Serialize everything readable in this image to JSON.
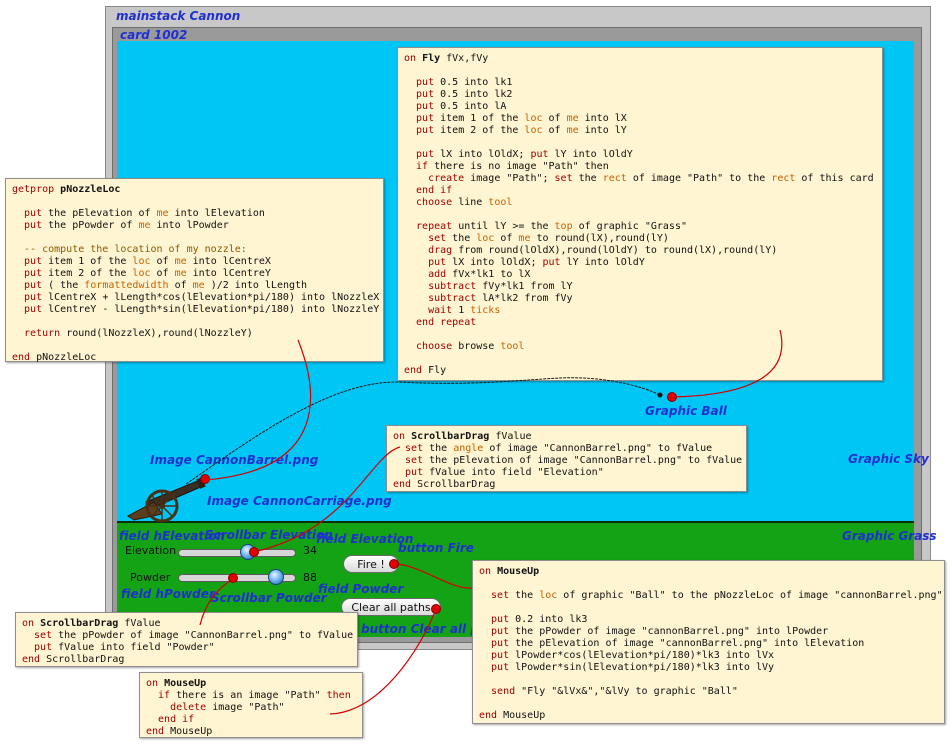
{
  "labels": {
    "mainstack": "mainstack Cannon",
    "card": "card 1002",
    "graphic_sky": "Graphic Sky",
    "graphic_grass": "Graphic Grass",
    "graphic_ball": "Graphic Ball",
    "image_barrel": "Image CannonBarrel.png",
    "image_carriage": "Image CannonCarriage.png",
    "field_helevation": "field hElevation",
    "scrollbar_elevation": "Scrollbar Elevation",
    "field_elevation": "field Elevation",
    "button_fire": "button Fire",
    "field_hpowder": "field hPowder",
    "scrollbar_powder": "Scrollbar Powder",
    "field_powder": "field Powder",
    "button_clear": "button Clear all paths"
  },
  "controls": {
    "elevation_label": "Elevation",
    "elevation_value": "34",
    "elevation_fraction": 0.34,
    "powder_label": "Powder",
    "powder_value": "88",
    "powder_fraction": 0.88,
    "fire_label": "Fire !",
    "clear_label": "Clear all paths"
  },
  "scripts": {
    "fly": [
      [
        {
          "c": "kw",
          "t": "on "
        },
        {
          "c": "bold",
          "t": "Fly"
        },
        {
          "c": "pl",
          "t": " fVx,fVy"
        }
      ],
      [],
      [
        {
          "c": "kw",
          "t": "  put"
        },
        {
          "c": "pl",
          "t": " 0.5 into lk1"
        }
      ],
      [
        {
          "c": "kw",
          "t": "  put"
        },
        {
          "c": "pl",
          "t": " 0.5 into lk2"
        }
      ],
      [
        {
          "c": "kw",
          "t": "  put"
        },
        {
          "c": "pl",
          "t": " 0.5 into lA"
        }
      ],
      [
        {
          "c": "kw",
          "t": "  put"
        },
        {
          "c": "pl",
          "t": " item 1 of the "
        },
        {
          "c": "or",
          "t": "loc"
        },
        {
          "c": "pl",
          "t": " of "
        },
        {
          "c": "or",
          "t": "me"
        },
        {
          "c": "pl",
          "t": " into lX"
        }
      ],
      [
        {
          "c": "kw",
          "t": "  put"
        },
        {
          "c": "pl",
          "t": " item 2 of the "
        },
        {
          "c": "or",
          "t": "loc"
        },
        {
          "c": "pl",
          "t": " of "
        },
        {
          "c": "or",
          "t": "me"
        },
        {
          "c": "pl",
          "t": " into lY"
        }
      ],
      [],
      [
        {
          "c": "kw",
          "t": "  put"
        },
        {
          "c": "pl",
          "t": " lX into lOldX; "
        },
        {
          "c": "kw",
          "t": "put"
        },
        {
          "c": "pl",
          "t": " lY into lOldY"
        }
      ],
      [
        {
          "c": "kw",
          "t": "  if"
        },
        {
          "c": "pl",
          "t": " there is no image \"Path\" then"
        }
      ],
      [
        {
          "c": "kw",
          "t": "    create"
        },
        {
          "c": "pl",
          "t": " image \"Path\"; "
        },
        {
          "c": "kw",
          "t": "set"
        },
        {
          "c": "pl",
          "t": " the "
        },
        {
          "c": "or",
          "t": "rect"
        },
        {
          "c": "pl",
          "t": " of image \"Path\" to the "
        },
        {
          "c": "or",
          "t": "rect"
        },
        {
          "c": "pl",
          "t": " of this card"
        }
      ],
      [
        {
          "c": "kw",
          "t": "  end if"
        }
      ],
      [
        {
          "c": "kw",
          "t": "  choose"
        },
        {
          "c": "pl",
          "t": " line "
        },
        {
          "c": "or",
          "t": "tool"
        }
      ],
      [],
      [
        {
          "c": "kw",
          "t": "  repeat"
        },
        {
          "c": "pl",
          "t": " until lY >= the "
        },
        {
          "c": "or",
          "t": "top"
        },
        {
          "c": "pl",
          "t": " of graphic \"Grass\""
        }
      ],
      [
        {
          "c": "kw",
          "t": "    set"
        },
        {
          "c": "pl",
          "t": " the "
        },
        {
          "c": "or",
          "t": "loc"
        },
        {
          "c": "pl",
          "t": " of "
        },
        {
          "c": "or",
          "t": "me"
        },
        {
          "c": "pl",
          "t": " to round(lX),round(lY)"
        }
      ],
      [
        {
          "c": "kw",
          "t": "    drag"
        },
        {
          "c": "pl",
          "t": " from round(lOldX),round(lOldY) to round(lX),round(lY)"
        }
      ],
      [
        {
          "c": "kw",
          "t": "    put"
        },
        {
          "c": "pl",
          "t": " lX into lOldX; "
        },
        {
          "c": "kw",
          "t": "put"
        },
        {
          "c": "pl",
          "t": " lY into lOldY"
        }
      ],
      [
        {
          "c": "kw",
          "t": "    add"
        },
        {
          "c": "pl",
          "t": " fVx*lk1 to lX"
        }
      ],
      [
        {
          "c": "kw",
          "t": "    subtract"
        },
        {
          "c": "pl",
          "t": " fVy*lk1 from lY"
        }
      ],
      [
        {
          "c": "kw",
          "t": "    subtract"
        },
        {
          "c": "pl",
          "t": " lA*lk2 from fVy"
        }
      ],
      [
        {
          "c": "kw",
          "t": "    wait"
        },
        {
          "c": "pl",
          "t": " 1 "
        },
        {
          "c": "or",
          "t": "ticks"
        }
      ],
      [
        {
          "c": "kw",
          "t": "  end repeat"
        }
      ],
      [],
      [
        {
          "c": "kw",
          "t": "  choose"
        },
        {
          "c": "pl",
          "t": " browse "
        },
        {
          "c": "or",
          "t": "tool"
        }
      ],
      [],
      [
        {
          "c": "kw",
          "t": "end "
        },
        {
          "c": "pl",
          "t": "Fly"
        }
      ]
    ],
    "nozzle": [
      [
        {
          "c": "kw",
          "t": "getprop "
        },
        {
          "c": "bold",
          "t": "pNozzleLoc"
        }
      ],
      [],
      [
        {
          "c": "kw",
          "t": "  put"
        },
        {
          "c": "pl",
          "t": " the pElevation of "
        },
        {
          "c": "or",
          "t": "me"
        },
        {
          "c": "pl",
          "t": " into lElevation"
        }
      ],
      [
        {
          "c": "kw",
          "t": "  put"
        },
        {
          "c": "pl",
          "t": " the pPowder of "
        },
        {
          "c": "or",
          "t": "me"
        },
        {
          "c": "pl",
          "t": " into lPowder"
        }
      ],
      [],
      [
        {
          "c": "cm",
          "t": "  -- compute the location of my nozzle:"
        }
      ],
      [
        {
          "c": "kw",
          "t": "  put"
        },
        {
          "c": "pl",
          "t": " item 1 of the "
        },
        {
          "c": "or",
          "t": "loc"
        },
        {
          "c": "pl",
          "t": " of "
        },
        {
          "c": "or",
          "t": "me"
        },
        {
          "c": "pl",
          "t": " into lCentreX"
        }
      ],
      [
        {
          "c": "kw",
          "t": "  put"
        },
        {
          "c": "pl",
          "t": " item 2 of the "
        },
        {
          "c": "or",
          "t": "loc"
        },
        {
          "c": "pl",
          "t": " of "
        },
        {
          "c": "or",
          "t": "me"
        },
        {
          "c": "pl",
          "t": " into lCentreY"
        }
      ],
      [
        {
          "c": "kw",
          "t": "  put"
        },
        {
          "c": "pl",
          "t": " ( the "
        },
        {
          "c": "or",
          "t": "formattedwidth"
        },
        {
          "c": "pl",
          "t": " of "
        },
        {
          "c": "or",
          "t": "me"
        },
        {
          "c": "pl",
          "t": " )/2 into lLength"
        }
      ],
      [
        {
          "c": "kw",
          "t": "  put"
        },
        {
          "c": "pl",
          "t": " lCentreX + lLength*cos(lElevation*pi/180) into lNozzleX"
        }
      ],
      [
        {
          "c": "kw",
          "t": "  put"
        },
        {
          "c": "pl",
          "t": " lCentreY - lLength*sin(lElevation*pi/180) into lNozzleY"
        }
      ],
      [],
      [
        {
          "c": "kw",
          "t": "  return"
        },
        {
          "c": "pl",
          "t": " round(lNozzleX),round(lNozzleY)"
        }
      ],
      [],
      [
        {
          "c": "kw",
          "t": "end "
        },
        {
          "c": "pl",
          "t": "pNozzleLoc"
        }
      ]
    ],
    "scroll_elev": [
      [
        {
          "c": "kw",
          "t": "on "
        },
        {
          "c": "bold",
          "t": "ScrollbarDrag"
        },
        {
          "c": "pl",
          "t": " fValue"
        }
      ],
      [
        {
          "c": "kw",
          "t": "  set"
        },
        {
          "c": "pl",
          "t": " the "
        },
        {
          "c": "or",
          "t": "angle"
        },
        {
          "c": "pl",
          "t": " of image \"CannonBarrel.png\" to fValue"
        }
      ],
      [
        {
          "c": "kw",
          "t": "  set"
        },
        {
          "c": "pl",
          "t": " the pElevation of image \"CannonBarrel.png\" to fValue"
        }
      ],
      [
        {
          "c": "kw",
          "t": "  put"
        },
        {
          "c": "pl",
          "t": " fValue into field \"Elevation\""
        }
      ],
      [
        {
          "c": "kw",
          "t": "end "
        },
        {
          "c": "pl",
          "t": "ScrollbarDrag"
        }
      ]
    ],
    "mouseup_fire": [
      [
        {
          "c": "kw",
          "t": "on "
        },
        {
          "c": "bold",
          "t": "MouseUp"
        }
      ],
      [],
      [
        {
          "c": "kw",
          "t": "  set"
        },
        {
          "c": "pl",
          "t": " the "
        },
        {
          "c": "or",
          "t": "loc"
        },
        {
          "c": "pl",
          "t": " of graphic \"Ball\" to the pNozzleLoc of image \"cannonBarrel.png\""
        }
      ],
      [],
      [
        {
          "c": "kw",
          "t": "  put"
        },
        {
          "c": "pl",
          "t": " 0.2 into lk3"
        }
      ],
      [
        {
          "c": "kw",
          "t": "  put"
        },
        {
          "c": "pl",
          "t": " the pPowder of image \"cannonBarrel.png\" into lPowder"
        }
      ],
      [
        {
          "c": "kw",
          "t": "  put"
        },
        {
          "c": "pl",
          "t": " the pElevation of image \"cannonBarrel.png\" into lElevation"
        }
      ],
      [
        {
          "c": "kw",
          "t": "  put"
        },
        {
          "c": "pl",
          "t": " lPowder*cos(lElevation*pi/180)*lk3 into lVx"
        }
      ],
      [
        {
          "c": "kw",
          "t": "  put"
        },
        {
          "c": "pl",
          "t": " lPowder*sin(lElevation*pi/180)*lk3 into lVy"
        }
      ],
      [],
      [
        {
          "c": "kw",
          "t": "  send"
        },
        {
          "c": "pl",
          "t": " \"Fly \"&lVx&\",\"&lVy to graphic \"Ball\""
        }
      ],
      [],
      [
        {
          "c": "kw",
          "t": "end "
        },
        {
          "c": "pl",
          "t": "MouseUp"
        }
      ]
    ],
    "scroll_powder": [
      [
        {
          "c": "kw",
          "t": "on "
        },
        {
          "c": "bold",
          "t": "ScrollbarDrag"
        },
        {
          "c": "pl",
          "t": " fValue"
        }
      ],
      [
        {
          "c": "kw",
          "t": "  set"
        },
        {
          "c": "pl",
          "t": " the pPowder of image \"CannonBarrel.png\" to fValue"
        }
      ],
      [
        {
          "c": "kw",
          "t": "  put"
        },
        {
          "c": "pl",
          "t": " fValue into field \"Powder\""
        }
      ],
      [
        {
          "c": "kw",
          "t": "end "
        },
        {
          "c": "pl",
          "t": "ScrollbarDrag"
        }
      ]
    ],
    "mouseup_clear": [
      [
        {
          "c": "kw",
          "t": "on "
        },
        {
          "c": "bold",
          "t": "MouseUp"
        }
      ],
      [
        {
          "c": "kw",
          "t": "  if"
        },
        {
          "c": "pl",
          "t": " there is an image \"Path\" "
        },
        {
          "c": "kw",
          "t": "then"
        }
      ],
      [
        {
          "c": "kw",
          "t": "    delete"
        },
        {
          "c": "pl",
          "t": " image \"Path\""
        }
      ],
      [
        {
          "c": "kw",
          "t": "  end if"
        }
      ],
      [
        {
          "c": "kw",
          "t": "end "
        },
        {
          "c": "pl",
          "t": "MouseUp"
        }
      ]
    ]
  },
  "colors": {
    "sky": "#00c6f6",
    "grass": "#14a314",
    "label_blue": "#1f2fd0",
    "connector_red": "#d40000",
    "code_bg": "#fff5d2"
  },
  "icons": [
    "cannon-icon",
    "ball-icon"
  ]
}
